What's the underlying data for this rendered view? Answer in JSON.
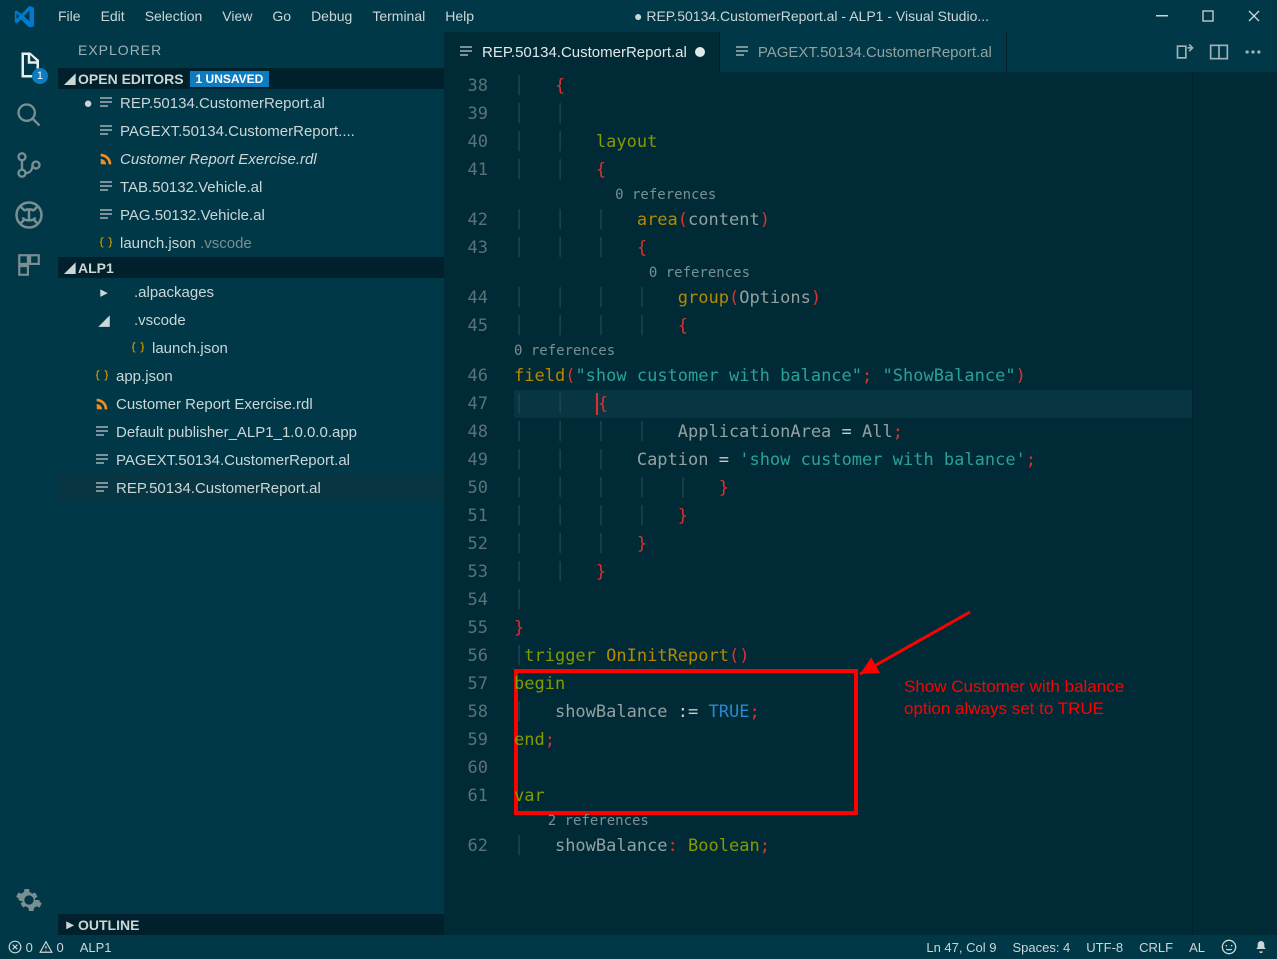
{
  "titlebar": {
    "modified_dot": "●",
    "title": "REP.50134.CustomerReport.al - ALP1 - Visual Studio..."
  },
  "menu": [
    "File",
    "Edit",
    "Selection",
    "View",
    "Go",
    "Debug",
    "Terminal",
    "Help"
  ],
  "activity_badge": "1",
  "sidebar": {
    "title": "EXPLORER",
    "open_editors_label": "OPEN EDITORS",
    "unsaved_label": "1 UNSAVED",
    "open_editors": [
      {
        "label": "REP.50134.CustomerReport.al",
        "modified": true,
        "icon": "lines"
      },
      {
        "label": "PAGEXT.50134.CustomerReport....",
        "modified": false,
        "icon": "lines"
      },
      {
        "label": "Customer Report Exercise.rdl",
        "modified": false,
        "icon": "rss",
        "italic": true
      },
      {
        "label": "TAB.50132.Vehicle.al",
        "modified": false,
        "icon": "lines"
      },
      {
        "label": "PAG.50132.Vehicle.al",
        "modified": false,
        "icon": "lines"
      },
      {
        "label": "launch.json",
        "suffix": ".vscode",
        "modified": false,
        "icon": "braces"
      }
    ],
    "project_label": "ALP1",
    "project_tree": [
      {
        "indent": 1,
        "chev": "▸",
        "icon": "",
        "label": ".alpackages"
      },
      {
        "indent": 1,
        "chev": "◢",
        "icon": "",
        "label": ".vscode"
      },
      {
        "indent": 2,
        "chev": "",
        "icon": "braces",
        "label": "launch.json"
      },
      {
        "indent": 0,
        "chev": "",
        "icon": "braces",
        "label": "app.json"
      },
      {
        "indent": 0,
        "chev": "",
        "icon": "rss",
        "label": "Customer Report Exercise.rdl"
      },
      {
        "indent": 0,
        "chev": "",
        "icon": "lines",
        "label": "Default publisher_ALP1_1.0.0.0.app"
      },
      {
        "indent": 0,
        "chev": "",
        "icon": "lines",
        "label": "PAGEXT.50134.CustomerReport.al"
      },
      {
        "indent": 0,
        "chev": "",
        "icon": "lines",
        "label": "REP.50134.CustomerReport.al",
        "selected": true
      }
    ],
    "outline_label": "OUTLINE"
  },
  "tabs": [
    {
      "label": "REP.50134.CustomerReport.al",
      "active": true,
      "modified": true
    },
    {
      "label": "PAGEXT.50134.CustomerReport.al",
      "active": false,
      "modified": false
    }
  ],
  "code": {
    "lines": [
      {
        "n": 38,
        "html": "<span class='guide'>│   </span><span class='punc'>{</span>"
      },
      {
        "n": 39,
        "html": "<span class='guide'>│   │</span>"
      },
      {
        "n": 40,
        "html": "<span class='guide'>│   │   </span><span class='kw'>layout</span>"
      },
      {
        "n": 41,
        "html": "<span class='guide'>│   │   </span><span class='punc'>{</span>",
        "codelens_after": "0 references",
        "codelens_pad": "            "
      },
      {
        "n": 42,
        "html": "<span class='guide'>│   │   │   </span><span class='fn'>area</span><span class='punc'>(</span>content<span class='punc'>)</span>"
      },
      {
        "n": 43,
        "html": "<span class='guide'>│   │   │   </span><span class='punc'>{</span>",
        "codelens_after": "0 references",
        "codelens_pad": "                "
      },
      {
        "n": 44,
        "html": "<span class='guide'>│   │   │   │   </span><span class='fn'>group</span><span class='punc'>(</span>Options<span class='punc'>)</span>"
      },
      {
        "n": 45,
        "html": "<span class='guide'>│   │   │   │   </span><span class='punc'>{</span>",
        "codelens_after": "0 references",
        "codelens_pad": ""
      },
      {
        "n": 46,
        "html": "<span class='fn'>field</span><span class='punc'>(</span><span class='str'>\"show customer with balance\"</span><span class='punc'>;</span> <span class='str'>\"ShowBalance\"</span><span class='punc'>)</span>"
      },
      {
        "n": 47,
        "html": "<span class='guide'>│   │   </span><span class='cursor-mark'></span><span class='punc'>{</span>",
        "highlight": true
      },
      {
        "n": 48,
        "html": "<span class='guide'>│   │   │   │   </span>ApplicationArea <span class='eq'>=</span> All<span class='punc'>;</span>"
      },
      {
        "n": 49,
        "html": "<span class='guide'>│   │   │   </span>Caption <span class='eq'>=</span> <span class='str'>'show customer with balance'</span><span class='punc'>;</span>"
      },
      {
        "n": 50,
        "html": "<span class='guide'>│   │   │   │   │   </span><span class='punc'>}</span>"
      },
      {
        "n": 51,
        "html": "<span class='guide'>│   │   │   │   </span><span class='punc'>}</span>"
      },
      {
        "n": 52,
        "html": "<span class='guide'>│   │   │   </span><span class='punc'>}</span>"
      },
      {
        "n": 53,
        "html": "<span class='guide'>│   │   </span><span class='punc'>}</span>"
      },
      {
        "n": 54,
        "html": "<span class='guide'>│</span>"
      },
      {
        "n": 55,
        "html": "<span class='punc'>}</span>"
      },
      {
        "n": 56,
        "html": "<span class='guide'>│</span><span class='kw'>trigger</span> <span class='fn'>OnInitReport</span><span class='punc'>()</span>"
      },
      {
        "n": 57,
        "html": "<span class='kw'>begin</span>"
      },
      {
        "n": 58,
        "html": "<span class='guide'>│   </span>showBalance <span class='eq'>:=</span> <span class='ident'>TRUE</span><span class='punc'>;</span>"
      },
      {
        "n": 59,
        "html": "<span class='kw'>end</span><span class='punc'>;</span>"
      },
      {
        "n": 60,
        "html": ""
      },
      {
        "n": 61,
        "html": "<span class='kw'>var</span>",
        "codelens_after": "2 references",
        "codelens_pad": "    "
      },
      {
        "n": 62,
        "html": "<span class='guide'>│   </span>showBalance<span class='punc'>:</span> <span class='kw'>Boolean</span><span class='punc'>;</span>"
      }
    ]
  },
  "annotation": {
    "line1": "Show Customer with balance",
    "line2": "option always set to TRUE"
  },
  "statusbar": {
    "errors": "0",
    "warnings": "0",
    "project": "ALP1",
    "lncol": "Ln 47, Col 9",
    "spaces": "Spaces: 4",
    "encoding": "UTF-8",
    "eol": "CRLF",
    "lang": "AL"
  }
}
